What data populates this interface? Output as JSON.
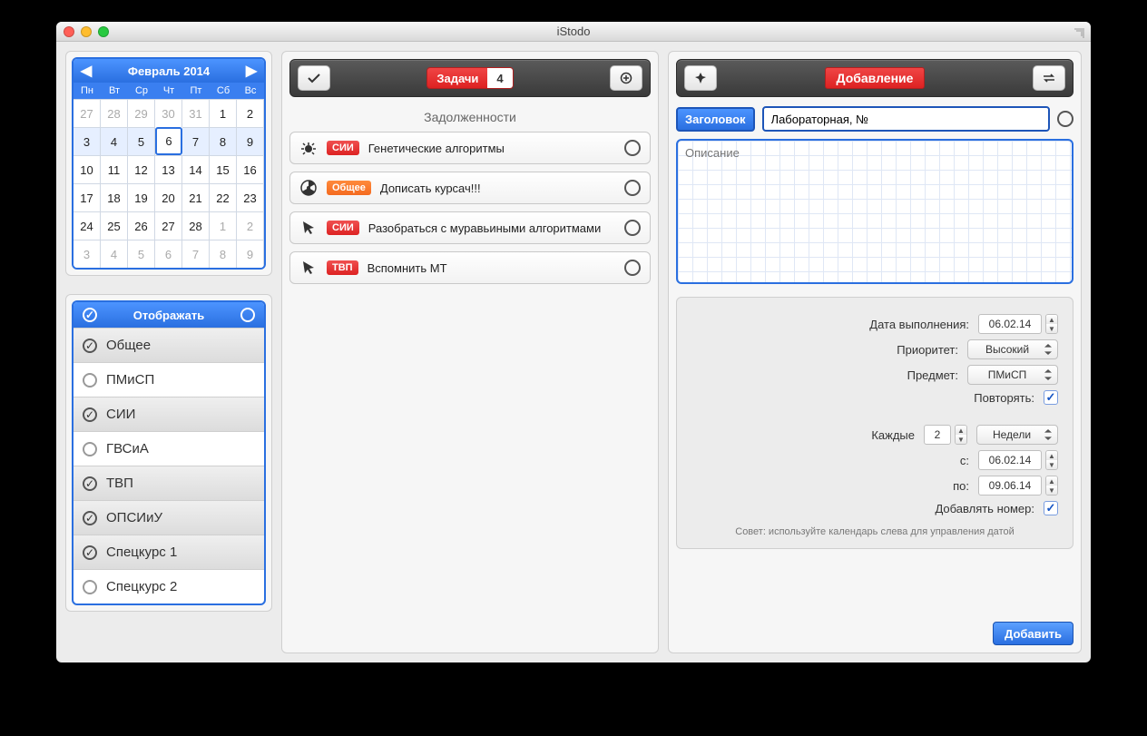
{
  "window": {
    "title": "iStodo"
  },
  "calendar": {
    "title": "Февраль 2014",
    "dow": [
      "Пн",
      "Вт",
      "Ср",
      "Чт",
      "Пт",
      "Сб",
      "Вс"
    ],
    "rows": [
      {
        "band": false,
        "cells": [
          {
            "n": "27",
            "dim": true
          },
          {
            "n": "28",
            "dim": true
          },
          {
            "n": "29",
            "dim": true
          },
          {
            "n": "30",
            "dim": true
          },
          {
            "n": "31",
            "dim": true
          },
          {
            "n": "1"
          },
          {
            "n": "2"
          }
        ]
      },
      {
        "band": true,
        "cells": [
          {
            "n": "3"
          },
          {
            "n": "4"
          },
          {
            "n": "5"
          },
          {
            "n": "6",
            "today": true
          },
          {
            "n": "7"
          },
          {
            "n": "8"
          },
          {
            "n": "9"
          }
        ]
      },
      {
        "band": false,
        "cells": [
          {
            "n": "10"
          },
          {
            "n": "11"
          },
          {
            "n": "12"
          },
          {
            "n": "13"
          },
          {
            "n": "14"
          },
          {
            "n": "15"
          },
          {
            "n": "16"
          }
        ]
      },
      {
        "band": false,
        "cells": [
          {
            "n": "17"
          },
          {
            "n": "18"
          },
          {
            "n": "19"
          },
          {
            "n": "20"
          },
          {
            "n": "21"
          },
          {
            "n": "22"
          },
          {
            "n": "23"
          }
        ]
      },
      {
        "band": false,
        "cells": [
          {
            "n": "24"
          },
          {
            "n": "25"
          },
          {
            "n": "26"
          },
          {
            "n": "27"
          },
          {
            "n": "28"
          },
          {
            "n": "1",
            "dim": true
          },
          {
            "n": "2",
            "dim": true
          }
        ]
      },
      {
        "band": false,
        "cells": [
          {
            "n": "3",
            "dim": true
          },
          {
            "n": "4",
            "dim": true
          },
          {
            "n": "5",
            "dim": true
          },
          {
            "n": "6",
            "dim": true
          },
          {
            "n": "7",
            "dim": true
          },
          {
            "n": "8",
            "dim": true
          },
          {
            "n": "9",
            "dim": true
          }
        ]
      }
    ]
  },
  "subjects": {
    "title": "Отображать",
    "items": [
      {
        "label": "Общее",
        "on": true,
        "sel": true
      },
      {
        "label": "ПМиСП",
        "on": false,
        "sel": false
      },
      {
        "label": "СИИ",
        "on": true,
        "sel": true
      },
      {
        "label": "ГВСиА",
        "on": false,
        "sel": false
      },
      {
        "label": "ТВП",
        "on": true,
        "sel": true
      },
      {
        "label": "ОПСИиУ",
        "on": true,
        "sel": true
      },
      {
        "label": "Спецкурс 1",
        "on": true,
        "sel": true
      },
      {
        "label": "Спецкурс 2",
        "on": false,
        "sel": false
      }
    ]
  },
  "tasks": {
    "tab_label": "Задачи",
    "count": "4",
    "section": "Задолженности",
    "items": [
      {
        "icon": "bug",
        "tag": "СИИ",
        "tag_color": "red",
        "text": "Генетические алгоритмы"
      },
      {
        "icon": "radiation",
        "tag": "Общее",
        "tag_color": "orange",
        "text": "Дописать курсач!!!"
      },
      {
        "icon": "cursor",
        "tag": "СИИ",
        "tag_color": "red",
        "text": "Разобраться с муравьиными алгоритмами"
      },
      {
        "icon": "cursor",
        "tag": "ТВП",
        "tag_color": "red",
        "text": "Вспомнить МТ"
      }
    ]
  },
  "compose": {
    "title": "Добавление",
    "head_label": "Заголовок",
    "head_value": "Лабораторная, №",
    "desc_placeholder": "Описание",
    "form": {
      "date_label": "Дата выполнения:",
      "date_value": "06.02.14",
      "priority_label": "Приоритет:",
      "priority_value": "Высокий",
      "subject_label": "Предмет:",
      "subject_value": "ПМиСП",
      "repeat_label": "Повторять:",
      "every_label": "Каждые",
      "every_value": "2",
      "every_unit": "Недели",
      "from_label": "с:",
      "from_value": "06.02.14",
      "to_label": "по:",
      "to_value": "09.06.14",
      "addnum_label": "Добавлять номер:"
    },
    "hint": "Совет: используйте календарь слева для управления датой",
    "add_label": "Добавить"
  }
}
